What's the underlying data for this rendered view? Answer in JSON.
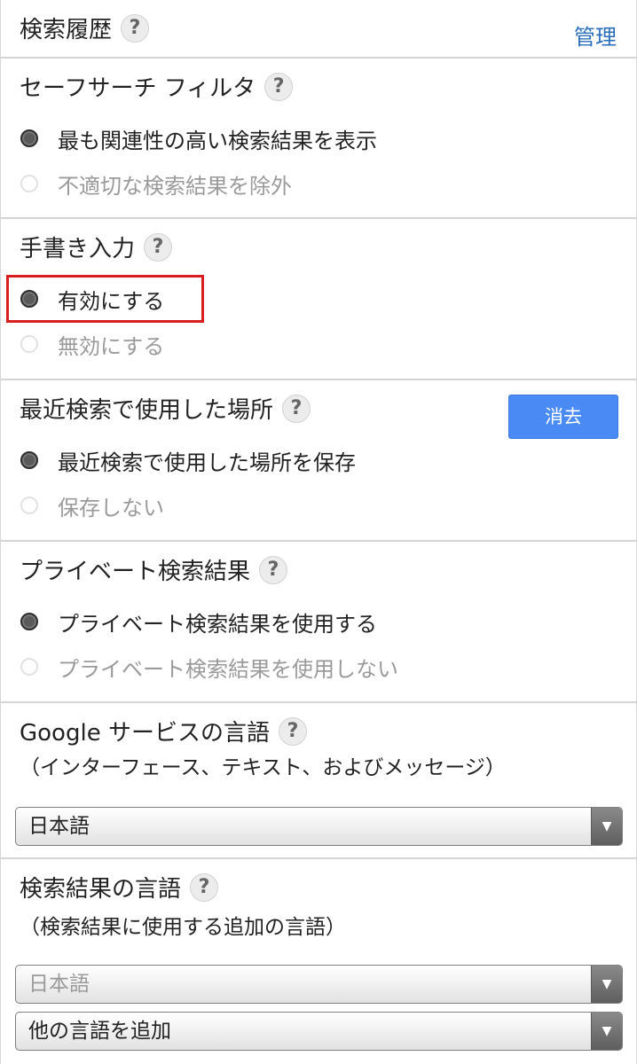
{
  "search_history": {
    "title": "検索履歴",
    "manage_link": "管理"
  },
  "safe_search": {
    "title": "セーフサーチ フィルタ",
    "options": [
      {
        "label": "最も関連性の高い検索結果を表示",
        "selected": true
      },
      {
        "label": "不適切な検索結果を除外",
        "selected": false
      }
    ]
  },
  "handwriting": {
    "title": "手書き入力",
    "options": [
      {
        "label": "有効にする",
        "selected": true
      },
      {
        "label": "無効にする",
        "selected": false
      }
    ]
  },
  "recent_locations": {
    "title": "最近検索で使用した場所",
    "clear_button": "消去",
    "options": [
      {
        "label": "最近検索で使用した場所を保存",
        "selected": true
      },
      {
        "label": "保存しない",
        "selected": false
      }
    ]
  },
  "private_results": {
    "title": "プライベート検索結果",
    "options": [
      {
        "label": "プライベート検索結果を使用する",
        "selected": true
      },
      {
        "label": "プライベート検索結果を使用しない",
        "selected": false
      }
    ]
  },
  "service_language": {
    "title": "Google サービスの言語",
    "subtitle": "（インターフェース、テキスト、およびメッセージ）",
    "selected": "日本語"
  },
  "result_language": {
    "title": "検索結果の言語",
    "subtitle": "（検索結果に使用する追加の言語）",
    "selected": "日本語",
    "add_label": "他の言語を追加"
  },
  "help_glyph": "?",
  "dropdown_glyph": "▼",
  "colors": {
    "link": "#2a6ebb",
    "button": "#4a8af4",
    "highlight": "#d81e1e"
  }
}
